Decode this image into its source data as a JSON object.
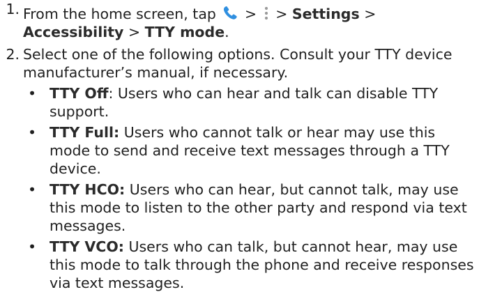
{
  "steps": [
    {
      "number": "1.",
      "text_a": "From the home screen, tap",
      "sep1": ">",
      "sep2": "> ",
      "settings": "Settings",
      "sep3": " > ",
      "accessibility": "Accessibility",
      "sep4": " >",
      "tty_mode": "TTY mode",
      "end": "."
    },
    {
      "number": "2.",
      "text": "Select one of the following options. Consult your TTY device manufacturer’s manual, if necessary."
    }
  ],
  "options": [
    {
      "name": "TTY Off",
      "desc": " Users who can hear and talk can disable TTY support."
    },
    {
      "name": "TTY Full:",
      "desc": " Users who cannot talk or hear may use this mode to send and receive text messages through a TTY device."
    },
    {
      "name": "TTY HCO:",
      "desc": " Users who can hear, but cannot talk, may use this mode to listen to the other party and respond via text messages."
    },
    {
      "name": "TTY VCO:",
      "desc": " Users who can talk, but cannot hear, may use this mode to talk through the phone and receive responses via text messages."
    }
  ],
  "option_first_colon": ":",
  "bullet": "•",
  "icons": {
    "phone": "phone-icon",
    "more": "more-vertical-icon"
  },
  "colors": {
    "phone_icon": "#2f8fe0",
    "more_icon": "#9a9a9a"
  }
}
